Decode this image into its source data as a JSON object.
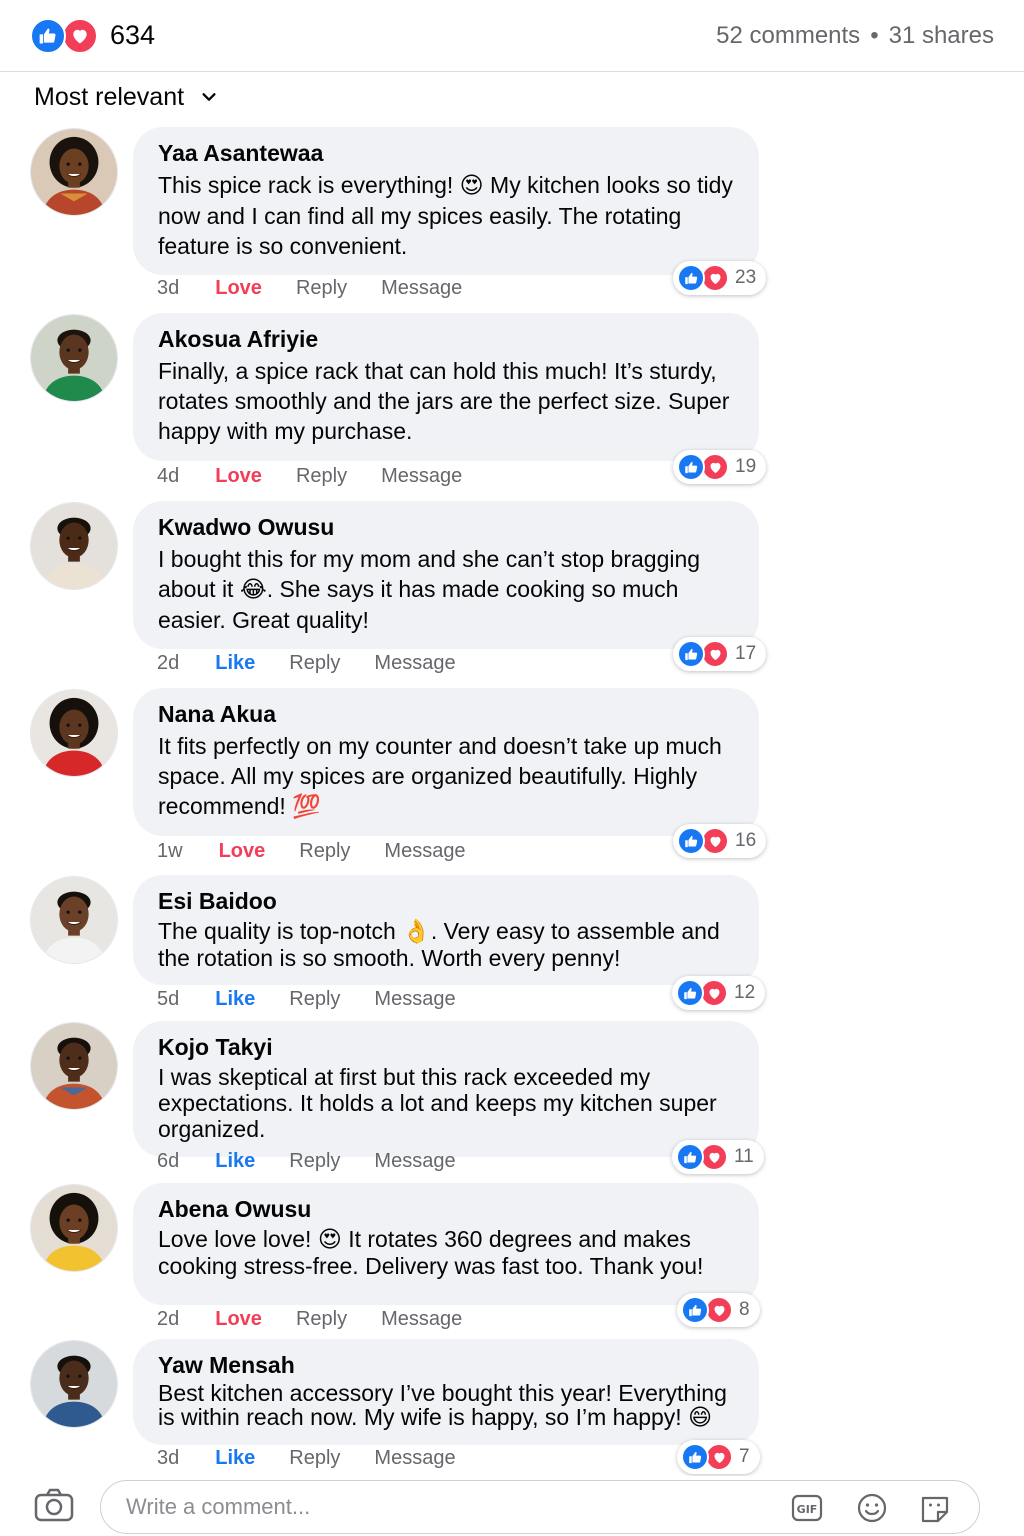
{
  "header": {
    "reaction_count": "634",
    "comments_label": "52 comments",
    "separator": "•",
    "shares_label": "31 shares"
  },
  "sort": {
    "label": "Most relevant"
  },
  "comments": [
    {
      "author": "Yaa Asantewaa",
      "text_before": "This spice rack is everything! ",
      "emoji": "😍",
      "text_after": " My kitchen looks so tidy now and I can find all my spices easily. The rotating feature is so convenient.",
      "time": "3d",
      "reaction_label": "Love",
      "reply_label": "Reply",
      "message_label": "Message",
      "reaction_total": "23"
    },
    {
      "author": "Akosua Afriyie",
      "text_before": "Finally, a spice rack that can hold this much! It’s sturdy, rotates smoothly and the jars are the perfect size. Super happy with my purchase.",
      "emoji": "",
      "text_after": "",
      "time": "4d",
      "reaction_label": "Love",
      "reply_label": "Reply",
      "message_label": "Message",
      "reaction_total": "19"
    },
    {
      "author": "Kwadwo Owusu",
      "text_before": "I bought this for my mom and she can’t stop bragging about it ",
      "emoji": "😂",
      "text_after": ". She says it has made cooking so much easier. Great quality!",
      "time": "2d",
      "reaction_label": "Like",
      "reply_label": "Reply",
      "message_label": "Message",
      "reaction_total": "17"
    },
    {
      "author": "Nana Akua",
      "text_before": "It fits perfectly on my counter and doesn’t take up much space. All my spices are organized beautifully. Highly recommend! ",
      "emoji": "💯",
      "text_after": "",
      "time": "1w",
      "reaction_label": "Love",
      "reply_label": "Reply",
      "message_label": "Message",
      "reaction_total": "16"
    },
    {
      "author": "Esi Baidoo",
      "text_before": "The quality is top-notch ",
      "emoji": "👌",
      "text_after": ". Very easy to assemble and the rotation is so smooth. Worth every penny!",
      "time": "5d",
      "reaction_label": "Like",
      "reply_label": "Reply",
      "message_label": "Message",
      "reaction_total": "12"
    },
    {
      "author": "Kojo Takyi",
      "text_before": "I was skeptical at first but this rack exceeded my expectations. It holds a lot and keeps my kitchen super organized.",
      "emoji": "",
      "text_after": "",
      "time": "6d",
      "reaction_label": "Like",
      "reply_label": "Reply",
      "message_label": "Message",
      "reaction_total": "11"
    },
    {
      "author": "Abena Owusu",
      "text_before": "Love love love! ",
      "emoji": "😍",
      "text_after": " It rotates 360 degrees and makes cooking stress-free. Delivery was fast too. Thank you!",
      "time": "2d",
      "reaction_label": "Love",
      "reply_label": "Reply",
      "message_label": "Message",
      "reaction_total": "8"
    },
    {
      "author": "Yaw Mensah",
      "text_before": "Best kitchen accessory I’ve bought this year! Everything is within reach now. My wife is happy, so I’m happy! ",
      "emoji": "😄",
      "text_after": "",
      "time": "3d",
      "reaction_label": "Like",
      "reply_label": "Reply",
      "message_label": "Message",
      "reaction_total": "7"
    }
  ],
  "composer": {
    "placeholder": "Write a comment..."
  },
  "colors": {
    "like_blue": "#1877f2",
    "love_red": "#f33e58",
    "bubble_bg": "#f0f2f5",
    "muted_text": "#65676b"
  },
  "icons": [
    "like-icon",
    "love-icon",
    "chevron-down-icon",
    "camera-icon",
    "gif-icon",
    "emoji-icon",
    "sticker-icon"
  ]
}
